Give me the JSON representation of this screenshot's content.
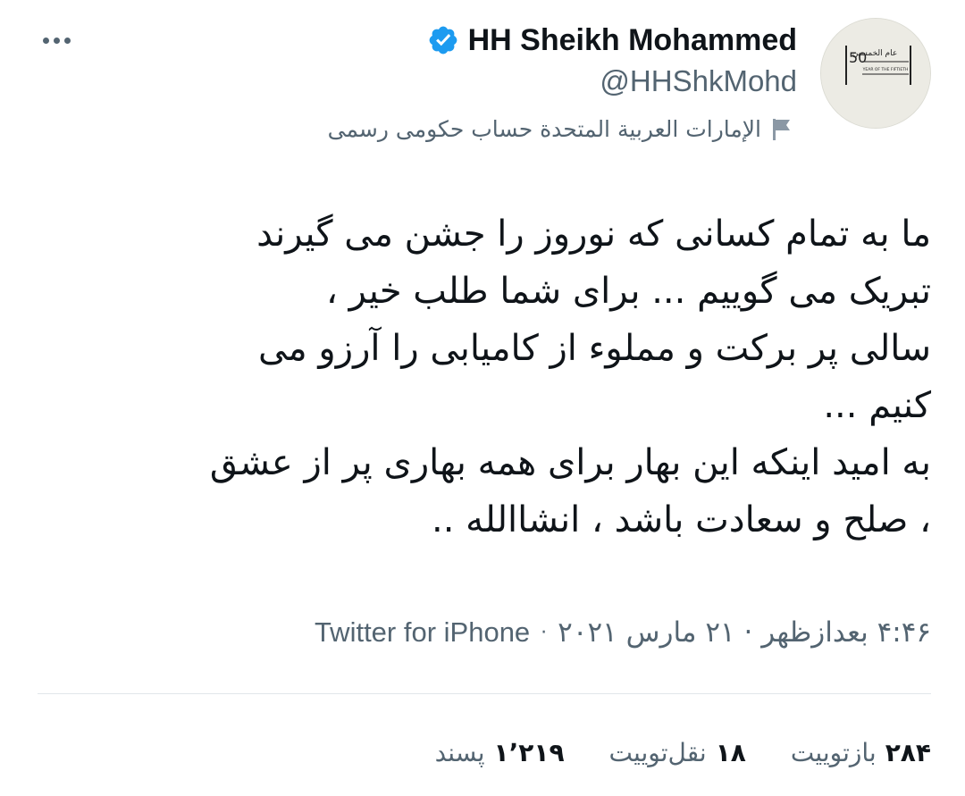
{
  "header": {
    "display_name": "HH Sheikh Mohammed",
    "handle": "@HHShkMohd",
    "account_label": "الإمارات العربية المتحدة حساب حكومى رسمى",
    "verified": true,
    "avatar": {
      "logo_text": "عام الخمسين",
      "logo_subtext": "YEAR OF THE FIFTIETH",
      "logo_number": "50",
      "background_color": "#ecebe4"
    },
    "more_icon": "more-horizontal-icon"
  },
  "tweet": {
    "lines": [
      "ما به تمام کسانی که  نوروز را جشن می گیرند",
      "تبریک می گوییم ... برای شما  طلب خیر ،",
      "سالی پر برکت  و مملوء از کامیابی را آرزو می",
      "کنیم ...",
      "به امید اینکه این بهار برای همه بهاری پر از عشق",
      "، صلح و سعادت باشد ، انشاالله .."
    ]
  },
  "meta": {
    "datetime": "۴:۴۶ بعدازظهر · ۲۱ مارس ۲۰۲۱",
    "separator": "·",
    "source": "Twitter for iPhone"
  },
  "stats": {
    "retweets": {
      "count": "۲۸۴",
      "label": "بازتوییت"
    },
    "quotes": {
      "count": "۱۸",
      "label": "نقل‌توییت"
    },
    "likes": {
      "count": "۱٬۲۱۹",
      "label": "پسند"
    }
  },
  "colors": {
    "text_primary": "#0f1419",
    "text_secondary": "#536471",
    "verified_blue": "#1d9bf0",
    "divider": "#e1e6ea"
  }
}
